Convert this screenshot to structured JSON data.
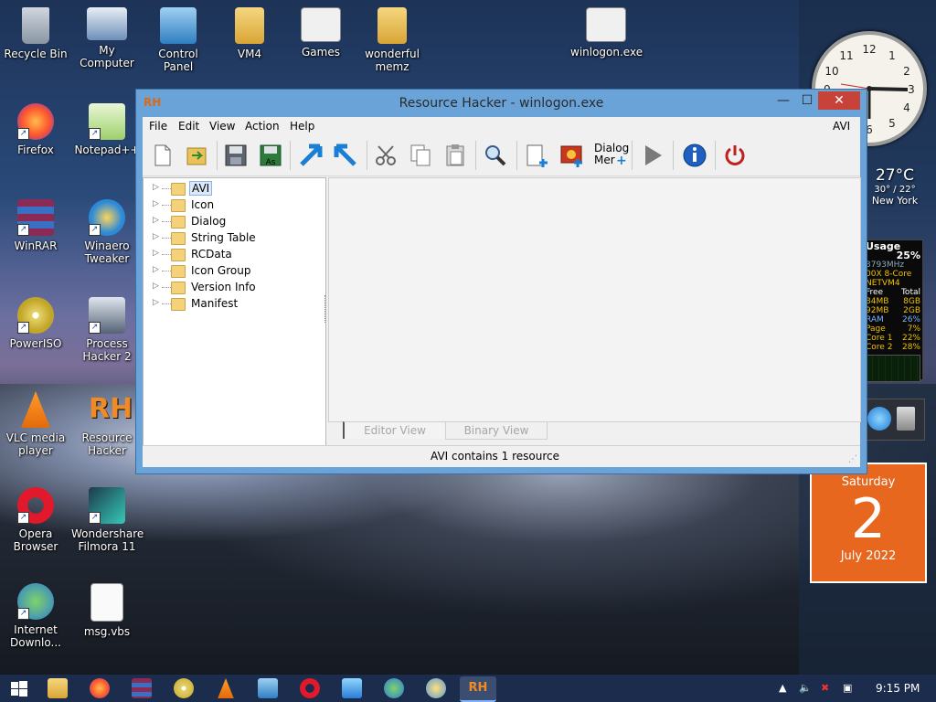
{
  "desktop": {
    "icons": [
      {
        "label": "Recycle Bin"
      },
      {
        "label": "My Computer"
      },
      {
        "label": "Control Panel"
      },
      {
        "label": "VM4"
      },
      {
        "label": "Games"
      },
      {
        "label": "wonderful memz"
      },
      {
        "label": "winlogon.exe"
      },
      {
        "label": "Firefox"
      },
      {
        "label": "Notepad++"
      },
      {
        "label": "WinRAR"
      },
      {
        "label": "Winaero Tweaker"
      },
      {
        "label": "PowerISO"
      },
      {
        "label": "Process Hacker 2"
      },
      {
        "label": "VLC media player"
      },
      {
        "label": "Resource Hacker"
      },
      {
        "label": "Opera Browser"
      },
      {
        "label": "Wondershare Filmora 11"
      },
      {
        "label": "Internet Downlo..."
      },
      {
        "label": "msg.vbs"
      }
    ]
  },
  "gadgets": {
    "weather": {
      "temp": "27°C",
      "range": "30° / 22°",
      "city": "New York"
    },
    "cpu": {
      "title": "Usage",
      "usage": "25%",
      "speed": "3793MHz",
      "cpu_name": "00X 8-Core",
      "host": "NETVM4",
      "rows": [
        {
          "a": "Free",
          "b": "Total"
        },
        {
          "a": "84MB",
          "b": "8GB"
        },
        {
          "a": "92MB",
          "b": "2GB"
        },
        {
          "a": "RAM",
          "b": "26%"
        },
        {
          "a": "Page",
          "b": "7%"
        },
        {
          "a": "Core 1",
          "b": "22%"
        },
        {
          "a": "Core 2",
          "b": "28%"
        }
      ]
    },
    "calendar": {
      "weekday": "Saturday",
      "day": "2",
      "month_year": "July 2022"
    }
  },
  "window": {
    "title": "Resource Hacker - winlogon.exe",
    "app_icon_text": "RH",
    "controls": {
      "minimize": "—",
      "maximize": "☐",
      "close": "✕"
    },
    "menu": {
      "file": "File",
      "edit": "Edit",
      "view": "View",
      "action": "Action",
      "help": "Help",
      "right_label": "AVI"
    },
    "toolbar": {
      "items": [
        "new-file-icon",
        "open-file-icon",
        "save-icon",
        "save-as-icon",
        "compile-arrow-icon",
        "back-arrow-icon",
        "cut-icon",
        "copy-icon",
        "paste-icon",
        "find-icon",
        "add-resource-icon",
        "add-image-icon",
        "dialog-menu-icon",
        "run-script-icon",
        "info-icon",
        "power-icon"
      ],
      "save_as_label": "As",
      "dialog_menu_label_1": "Dialog",
      "dialog_menu_label_2": "Mer"
    },
    "tree": {
      "items": [
        {
          "label": "AVI",
          "selected": true
        },
        {
          "label": "Icon"
        },
        {
          "label": "Dialog"
        },
        {
          "label": "String Table"
        },
        {
          "label": "RCData"
        },
        {
          "label": "Icon Group"
        },
        {
          "label": "Version Info"
        },
        {
          "label": "Manifest"
        }
      ]
    },
    "tabs": {
      "editor": "Editor View",
      "binary": "Binary View"
    },
    "status": "AVI contains 1 resource"
  },
  "taskbar": {
    "time": "9:15 PM",
    "icons": [
      "start-icon",
      "file-explorer-icon",
      "firefox-icon",
      "winrar-icon",
      "poweriso-icon",
      "vlc-icon",
      "control-panel-icon",
      "opera-icon",
      "process-hacker-icon",
      "idm-icon",
      "powertoys-icon",
      "resource-hacker-icon"
    ],
    "active_label": "RH"
  },
  "colors": {
    "accent": "#2b6cb0",
    "close": "#c7433a",
    "calendar": "#e8671f",
    "titlebar": "#6aa3d8"
  }
}
